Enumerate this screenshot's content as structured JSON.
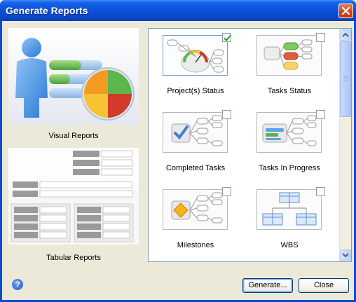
{
  "window": {
    "title": "Generate Reports"
  },
  "report_types": [
    {
      "label": "Visual Reports"
    },
    {
      "label": "Tabular Reports"
    }
  ],
  "reports": [
    {
      "label": "Project(s) Status",
      "checked": true,
      "icon": "status-gauge-icon"
    },
    {
      "label": "Tasks Status",
      "checked": false,
      "icon": "tasks-status-icon"
    },
    {
      "label": "Completed Tasks",
      "checked": false,
      "icon": "completed-check-icon"
    },
    {
      "label": "Tasks In Progress",
      "checked": false,
      "icon": "progress-bars-icon"
    },
    {
      "label": "Milestones",
      "checked": false,
      "icon": "milestone-diamond-icon"
    },
    {
      "label": "WBS",
      "checked": false,
      "icon": "wbs-tree-icon"
    }
  ],
  "footer": {
    "help": "?",
    "generate_label": "Generate...",
    "close_label": "Close"
  },
  "colors": {
    "title_bar": "#0a52d9",
    "dialog_bg": "#ece9d8",
    "accent_green": "#5eb94e",
    "accent_red": "#d23a2a",
    "accent_orange": "#f39a24"
  }
}
